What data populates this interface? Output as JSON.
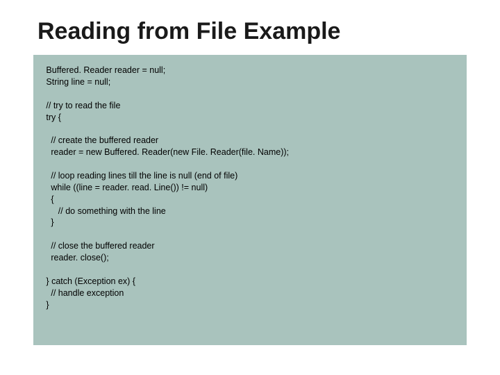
{
  "slide": {
    "title": "Reading from File Example",
    "code": "   Buffered. Reader reader = null;\n   String line = null;\n\n   // try to read the file\n   try {\n\n     // create the buffered reader\n     reader = new Buffered. Reader(new File. Reader(file. Name));\n\n     // loop reading lines till the line is null (end of file)\n     while ((line = reader. read. Line()) != null)\n     {\n        // do something with the line\n     }\n\n     // close the buffered reader\n     reader. close();\n\n   } catch (Exception ex) {\n     // handle exception\n   }"
  }
}
